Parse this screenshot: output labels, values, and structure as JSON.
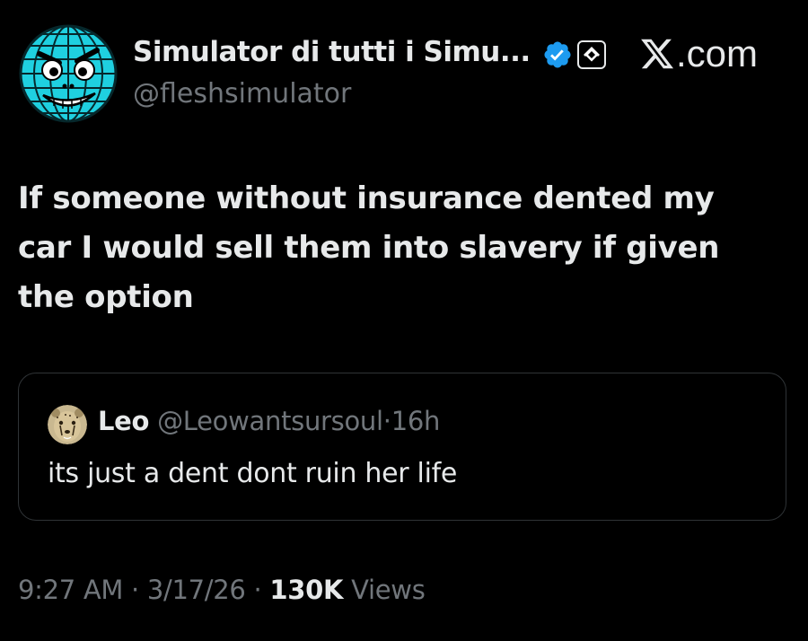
{
  "colors": {
    "background": "#000000",
    "primary_text": "#e7e9ea",
    "secondary_text": "#71767b",
    "verified": "#1d9bf0",
    "card_border": "#2f3336",
    "avatar_globe": "#1fd0e0"
  },
  "author": {
    "display_name": "Simulator di tutti i Simu...",
    "handle": "@fleshsimulator",
    "avatar_icon": "grinning-globe-face-icon",
    "verified_icon": "verified-badge-icon",
    "affiliate_icon": "affiliate-badge-icon"
  },
  "brand": {
    "label": ".com",
    "icon": "x-logo-icon"
  },
  "tweet": {
    "text": "If someone without insurance dented my car I would sell them into slavery if given the option"
  },
  "quoted_tweet": {
    "name": "Leo",
    "handle": "@Leowantsursoul",
    "separator": "·",
    "time": "16h",
    "text": "its just a dent dont ruin her life",
    "avatar_icon": "cheetah-avatar-icon"
  },
  "footer": {
    "time": "9:27 AM",
    "sep1": "·",
    "date": "3/17/26",
    "sep2": "·",
    "views_count": "130K",
    "views_label": "Views"
  }
}
